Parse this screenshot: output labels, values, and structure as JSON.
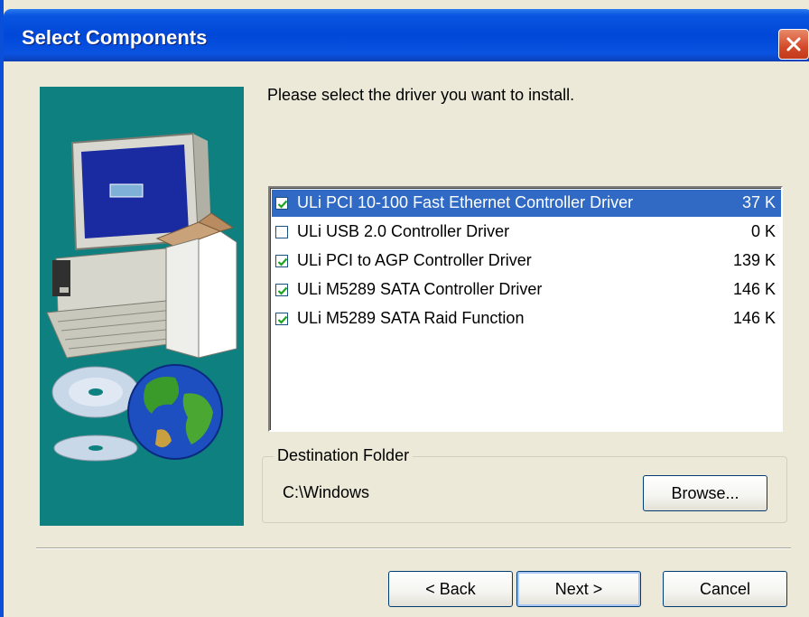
{
  "dialog": {
    "title": "Select Components",
    "instruction": "Please select the driver you want to install."
  },
  "components": [
    {
      "label": "ULi PCI 10-100 Fast Ethernet Controller Driver",
      "size": "37 K",
      "checked": true,
      "selected": true
    },
    {
      "label": "ULi USB 2.0 Controller Driver",
      "size": "0 K",
      "checked": false,
      "selected": false
    },
    {
      "label": "ULi PCI to AGP Controller Driver",
      "size": "139 K",
      "checked": true,
      "selected": false
    },
    {
      "label": "ULi M5289 SATA Controller Driver",
      "size": "146 K",
      "checked": true,
      "selected": false
    },
    {
      "label": "ULi M5289 SATA Raid Function",
      "size": "146 K",
      "checked": true,
      "selected": false
    }
  ],
  "destination": {
    "group_label": "Destination Folder",
    "path": "C:\\Windows",
    "browse_label": "Browse..."
  },
  "buttons": {
    "back": "< Back",
    "next": "Next >",
    "cancel": "Cancel"
  },
  "colors": {
    "title_bar": "#0048d8",
    "selection": "#316ac5",
    "panel": "#0e8080",
    "face": "#ece9d8"
  },
  "icons": [
    "close-icon",
    "computer-illustration",
    "cd-icon",
    "globe-icon"
  ]
}
